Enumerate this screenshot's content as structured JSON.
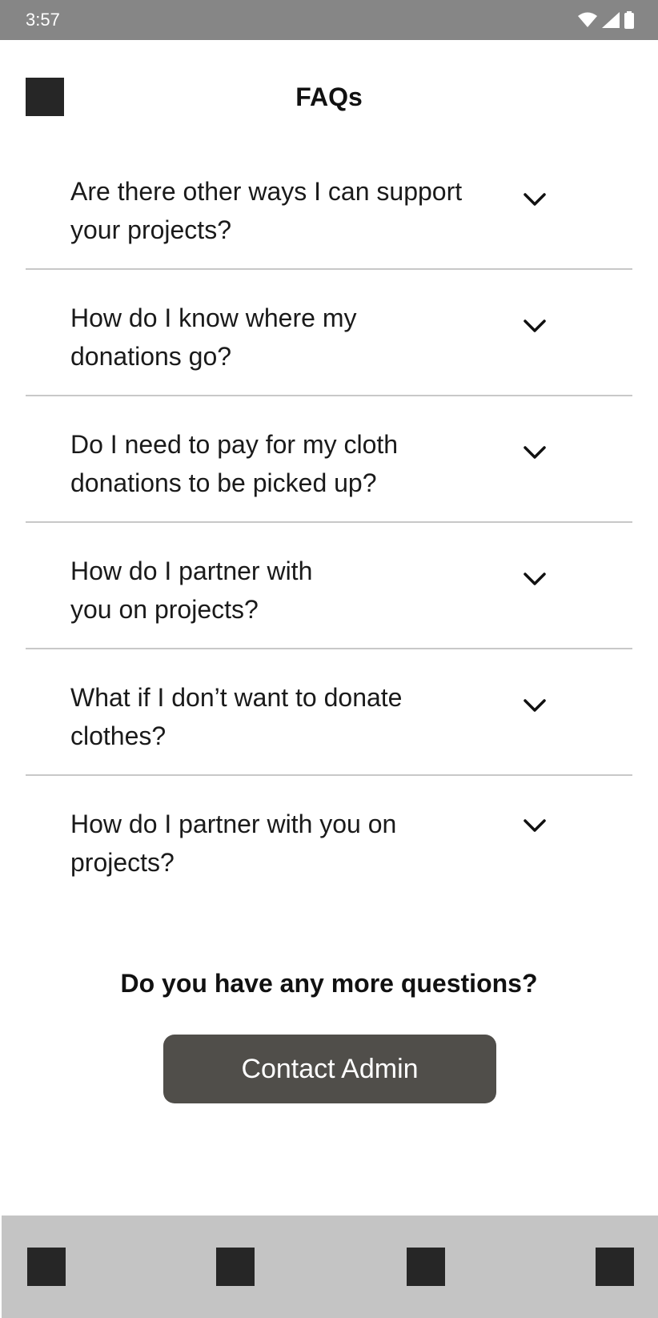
{
  "status_bar": {
    "time": "3:57",
    "icons": [
      "wifi-icon",
      "signal-icon",
      "battery-icon"
    ]
  },
  "header": {
    "title": "FAQs",
    "menu_icon": "menu-placeholder-icon"
  },
  "faqs": [
    {
      "question": "Are there other ways I can support your projects?"
    },
    {
      "question": "How do I know where my donations go?"
    },
    {
      "question": "Do I need to pay for my cloth donations to be picked up?"
    },
    {
      "question": "How do I partner with you on projects?"
    },
    {
      "question": "What if I don’t want to donate clothes?"
    },
    {
      "question": "How do I partner with you on projects?"
    }
  ],
  "more_questions": {
    "text": "Do you have any more questions?",
    "button_label": "Contact Admin"
  },
  "bottom_nav": {
    "items": [
      "nav-placeholder-icon",
      "nav-placeholder-icon",
      "nav-placeholder-icon",
      "nav-placeholder-icon"
    ]
  },
  "colors": {
    "status_bar": "#868686",
    "button": "#504e4a",
    "bottom_nav": "#c4c4c4",
    "placeholder": "#262626",
    "divider": "#c8c8c8"
  }
}
